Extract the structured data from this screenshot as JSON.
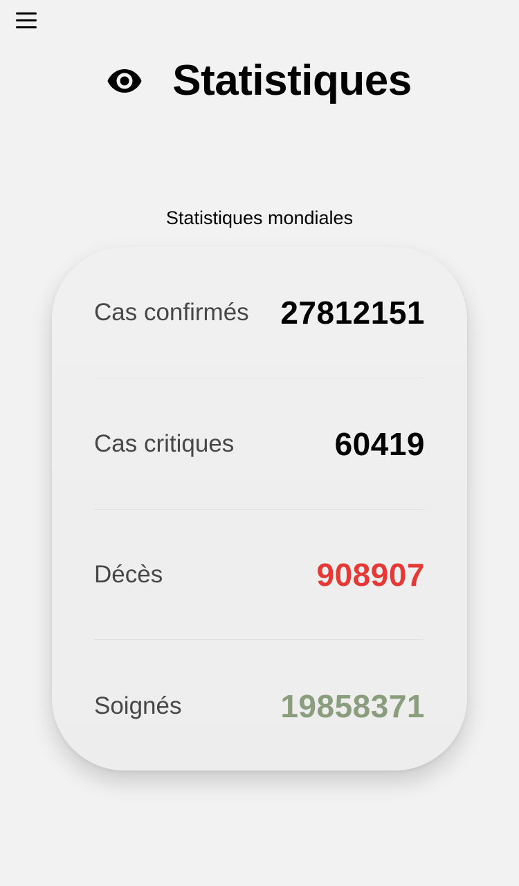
{
  "header": {
    "title": "Statistiques",
    "icon": "eye-icon",
    "menu_icon": "hamburger-menu-icon"
  },
  "section": {
    "title": "Statistiques mondiales"
  },
  "stats": [
    {
      "label": "Cas confirmés",
      "value": "27812151",
      "color": "#000000"
    },
    {
      "label": "Cas critiques",
      "value": "60419",
      "color": "#000000"
    },
    {
      "label": "Décès",
      "value": "908907",
      "color": "#e53935"
    },
    {
      "label": "Soignés",
      "value": "19858371",
      "color": "#8a9e7e"
    }
  ]
}
